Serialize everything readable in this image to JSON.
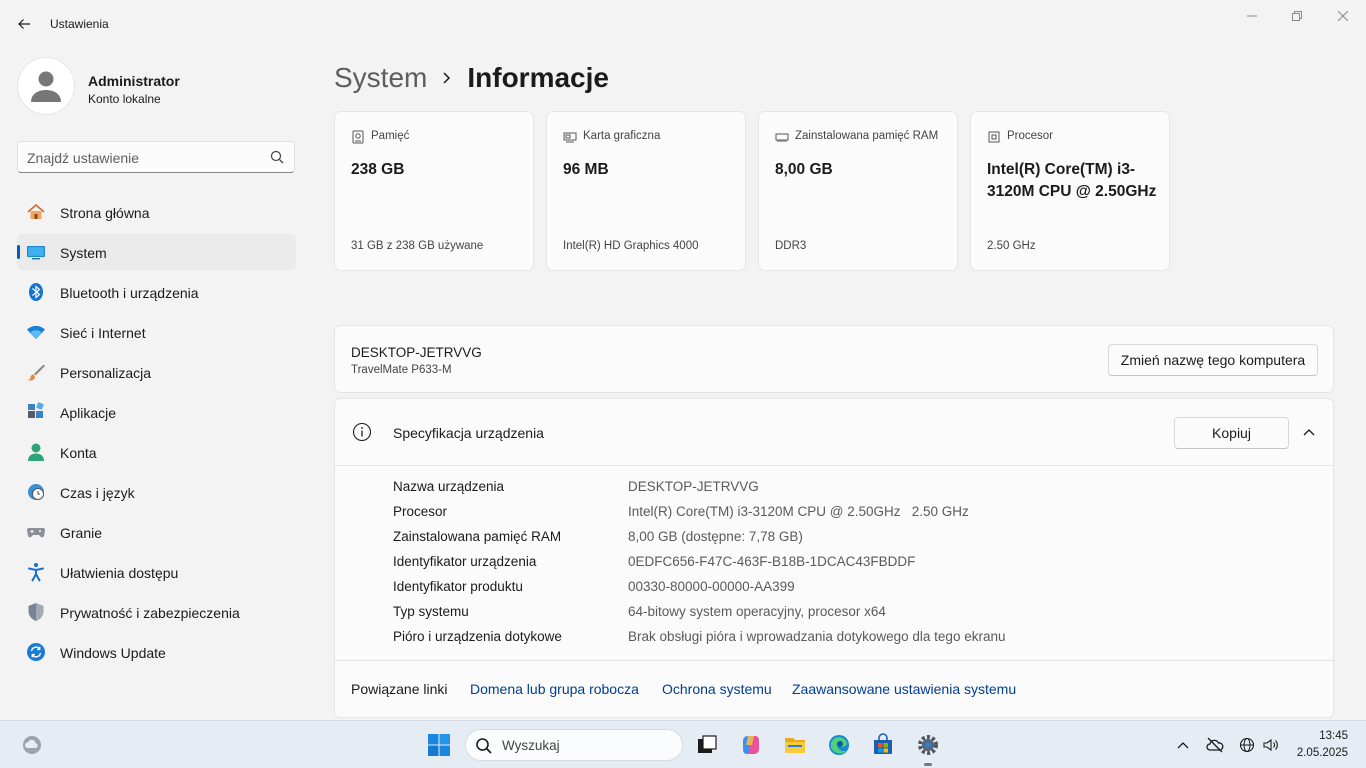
{
  "window": {
    "title": "Ustawienia"
  },
  "profile": {
    "name": "Administrator",
    "account_type": "Konto lokalne"
  },
  "search": {
    "placeholder": "Znajdź ustawienie"
  },
  "sidebar": {
    "items": [
      {
        "label": "Strona główna",
        "icon": "home-icon"
      },
      {
        "label": "System",
        "icon": "monitor-icon",
        "active": true
      },
      {
        "label": "Bluetooth i urządzenia",
        "icon": "bluetooth-icon"
      },
      {
        "label": "Sieć i Internet",
        "icon": "wifi-icon"
      },
      {
        "label": "Personalizacja",
        "icon": "brush-icon"
      },
      {
        "label": "Aplikacje",
        "icon": "apps-icon"
      },
      {
        "label": "Konta",
        "icon": "person-icon"
      },
      {
        "label": "Czas i język",
        "icon": "clock-globe-icon"
      },
      {
        "label": "Granie",
        "icon": "gamepad-icon"
      },
      {
        "label": "Ułatwienia dostępu",
        "icon": "accessibility-icon"
      },
      {
        "label": "Prywatność i zabezpieczenia",
        "icon": "shield-icon"
      },
      {
        "label": "Windows Update",
        "icon": "update-icon"
      }
    ]
  },
  "breadcrumb": {
    "parent": "System",
    "current": "Informacje"
  },
  "cards": [
    {
      "label": "Pamięć",
      "value": "238 GB",
      "sub": "31 GB z 238 GB używane",
      "icon": "storage-icon"
    },
    {
      "label": "Karta graficzna",
      "value": "96 MB",
      "sub": "Intel(R) HD Graphics 4000",
      "icon": "gpu-icon"
    },
    {
      "label": "Zainstalowana pamięć RAM",
      "value": "8,00 GB",
      "sub": "DDR3",
      "icon": "ram-icon"
    },
    {
      "label": "Procesor",
      "value": "Intel(R) Core(TM) i3-3120M CPU @ 2.50GHz",
      "sub": "2.50 GHz",
      "icon": "cpu-icon"
    }
  ],
  "device": {
    "name": "DESKTOP-JETRVVG",
    "model": "TravelMate P633-M",
    "rename_label": "Zmień nazwę tego komputera"
  },
  "specs": {
    "title": "Specyfikacja urządzenia",
    "copy_label": "Kopiuj",
    "rows": [
      {
        "key": "Nazwa urządzenia",
        "value": "DESKTOP-JETRVVG"
      },
      {
        "key": "Procesor",
        "value": "Intel(R) Core(TM) i3-3120M CPU @ 2.50GHz   2.50 GHz"
      },
      {
        "key": "Zainstalowana pamięć RAM",
        "value": "8,00 GB (dostępne: 7,78 GB)"
      },
      {
        "key": "Identyfikator urządzenia",
        "value": "0EDFC656-F47C-463F-B18B-1DCAC43FBDDF"
      },
      {
        "key": "Identyfikator produktu",
        "value": "00330-80000-00000-AA399"
      },
      {
        "key": "Typ systemu",
        "value": "64-bitowy system operacyjny, procesor x64"
      },
      {
        "key": "Pióro i urządzenia dotykowe",
        "value": "Brak obsługi pióra i wprowadzania dotykowego dla tego ekranu"
      }
    ]
  },
  "related_links": {
    "label": "Powiązane linki",
    "links": [
      "Domena lub grupa robocza",
      "Ochrona systemu",
      "Zaawansowane ustawienia systemu"
    ]
  },
  "taskbar": {
    "search_text": "Wyszukaj",
    "time": "13:45",
    "date": "2.05.2025"
  },
  "colors": {
    "accent": "#005fb8",
    "link": "#003e92",
    "background": "#f3f3f3",
    "card": "#fbfbfb"
  }
}
